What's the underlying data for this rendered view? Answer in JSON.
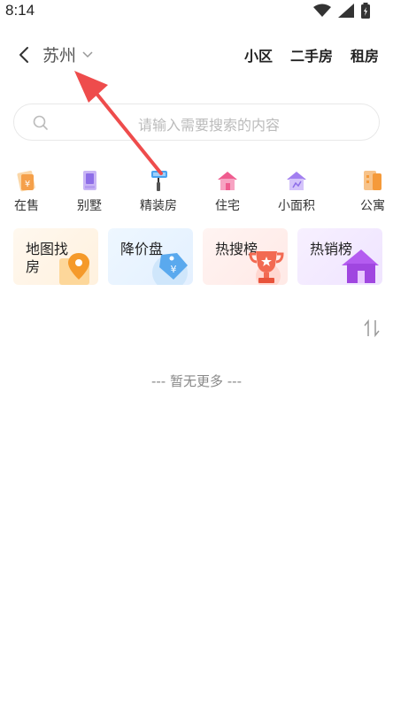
{
  "status": {
    "time": "8:14"
  },
  "header": {
    "city": "苏州",
    "nav": [
      "小区",
      "二手房",
      "租房"
    ]
  },
  "search": {
    "placeholder": "请输入需要搜索的内容"
  },
  "categories": [
    {
      "label": "在售",
      "icon": "on-sale-icon"
    },
    {
      "label": "别墅",
      "icon": "villa-icon"
    },
    {
      "label": "精装房",
      "icon": "paint-roller-icon"
    },
    {
      "label": "住宅",
      "icon": "house-icon"
    },
    {
      "label": "小面积",
      "icon": "small-house-icon"
    },
    {
      "label": "公寓",
      "icon": "apartment-icon"
    }
  ],
  "cards": [
    {
      "title": "地图找房",
      "icon": "map-pin-icon"
    },
    {
      "title": "降价盘",
      "icon": "price-tag-icon"
    },
    {
      "title": "热搜榜",
      "icon": "trophy-icon"
    },
    {
      "title": "热销榜",
      "icon": "purple-house-icon"
    }
  ],
  "list": {
    "empty_text": "--- 暂无更多 ---"
  },
  "colors": {
    "accent_red": "#f0474a",
    "annotation_arrow": "#ee4c4c"
  }
}
